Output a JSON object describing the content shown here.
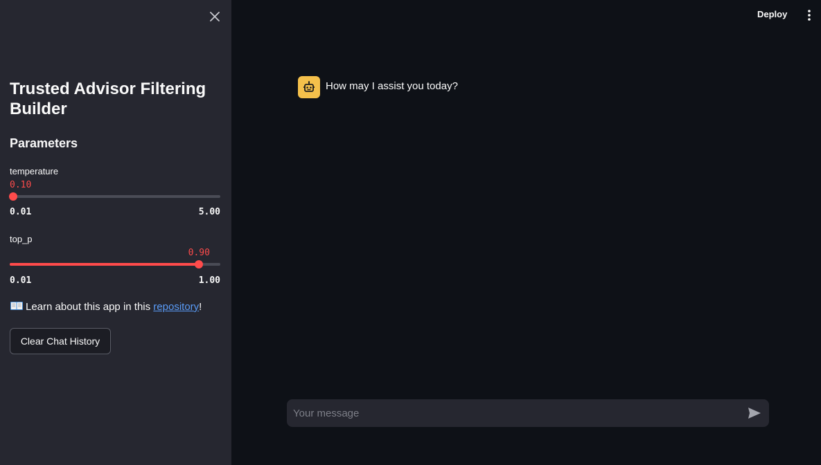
{
  "sidebar": {
    "title": "Trusted Advisor Filtering Builder",
    "parameters_heading": "Parameters",
    "temperature": {
      "label": "temperature",
      "value": "0.10",
      "min": "0.01",
      "max": "5.00",
      "fraction": 0.018
    },
    "top_p": {
      "label": "top_p",
      "value": "0.90",
      "min": "0.01",
      "max": "1.00",
      "fraction": 0.899
    },
    "learn": {
      "icon": "open-book-icon",
      "prefix": "Learn about this app in this ",
      "link": "repository",
      "suffix": "!"
    },
    "clear_button": "Clear Chat History"
  },
  "header": {
    "deploy": "Deploy"
  },
  "chat": {
    "messages": [
      {
        "role": "assistant",
        "avatar_icon": "robot-icon",
        "text": "How may I assist you today?"
      }
    ],
    "input_placeholder": "Your message",
    "send_icon": "send-icon"
  },
  "colors": {
    "accent": "#ff4b4b",
    "sidebar_bg": "#262730",
    "main_bg": "#0e1117",
    "avatar_bg": "#f4c04b",
    "link": "#5a9cf8"
  }
}
